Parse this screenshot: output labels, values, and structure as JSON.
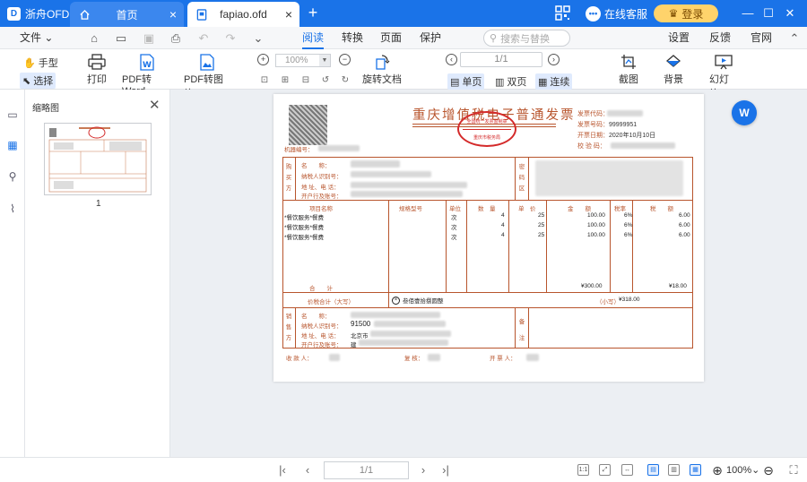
{
  "app": {
    "name": "浙舟OFD"
  },
  "tabs": [
    {
      "label": "首页"
    },
    {
      "label": "fapiao.ofd"
    }
  ],
  "titlebar": {
    "service_label": "在线客服",
    "login_label": "登录"
  },
  "menu": {
    "file_label": "文件",
    "tabs": [
      "阅读",
      "转换",
      "页面",
      "保护"
    ],
    "search_placeholder": "搜索与替换",
    "right": [
      "设置",
      "反馈",
      "官网"
    ]
  },
  "toolbar": {
    "hand_label": "手型",
    "select_label": "选择",
    "print_label": "打印",
    "pdf_word_label": "PDF转Word",
    "pdf_image_label": "PDF转图片",
    "zoom_value": "100%",
    "rotate_label": "旋转文档",
    "page_value": "1/1",
    "single_label": "单页",
    "double_label": "双页",
    "continuous_label": "连续",
    "screenshot_label": "截图",
    "background_label": "背景",
    "slideshow_label": "幻灯片"
  },
  "sidebar": {
    "title": "缩略图",
    "page_number": "1"
  },
  "invoice": {
    "title": "重庆增值税电子普通发票",
    "seal_top": "重庆市税务局",
    "seal_mid": "全国统一发票监制章",
    "meta": {
      "code_label": "发票代码：",
      "number_label": "发票号码：",
      "number_value": "99999951",
      "date_label": "开票日期：",
      "date_value": "2020年10月10日",
      "check_label": "校 验 码："
    },
    "machine_label": "机器编号：",
    "buyer_side": [
      "购",
      "买",
      "方"
    ],
    "buyer_fields": [
      "名　　称：",
      "纳税人识别号：",
      "地 址、电 话：",
      "开户行及账号："
    ],
    "password_side": [
      "密",
      "码",
      "区"
    ],
    "headers": {
      "item": "项目名称",
      "spec": "规格型号",
      "unit": "单位",
      "qty": "数　量",
      "price": "单　价",
      "amount": "金　　额",
      "rate": "税率",
      "tax": "税　　额"
    },
    "rows": [
      {
        "item": "*餐饮服务*餐费",
        "unit": "次",
        "qty": "4",
        "price": "25",
        "amount": "100.00",
        "rate": "6%",
        "tax": "6.00"
      },
      {
        "item": "*餐饮服务*餐费",
        "unit": "次",
        "qty": "4",
        "price": "25",
        "amount": "100.00",
        "rate": "6%",
        "tax": "6.00"
      },
      {
        "item": "*餐饮服务*餐费",
        "unit": "次",
        "qty": "4",
        "price": "25",
        "amount": "100.00",
        "rate": "6%",
        "tax": "6.00"
      }
    ],
    "total_label": "合　　计",
    "total_amount": "¥300.00",
    "total_tax": "¥18.00",
    "sum_label": "价税合计（大写）",
    "sum_words": "叁佰壹拾捌圆整",
    "sum_small_label": "（小写）",
    "sum_small_value": "¥318.00",
    "seller_side": [
      "销",
      "售",
      "方"
    ],
    "seller_fields": [
      "名　　称：",
      "纳税人识别号：",
      "地 址、电 话：",
      "开户行及账号："
    ],
    "seller_tax_partial": "91500",
    "seller_addr_partial": "北京市",
    "seller_bank_partial": "建",
    "remark_side": [
      "备",
      "注"
    ],
    "payee_label": "收 款 人：",
    "reviewer_label": "复 核：",
    "issuer_label": "开 票 人："
  },
  "statusbar": {
    "page_value": "1/1",
    "zoom_value": "100%"
  }
}
